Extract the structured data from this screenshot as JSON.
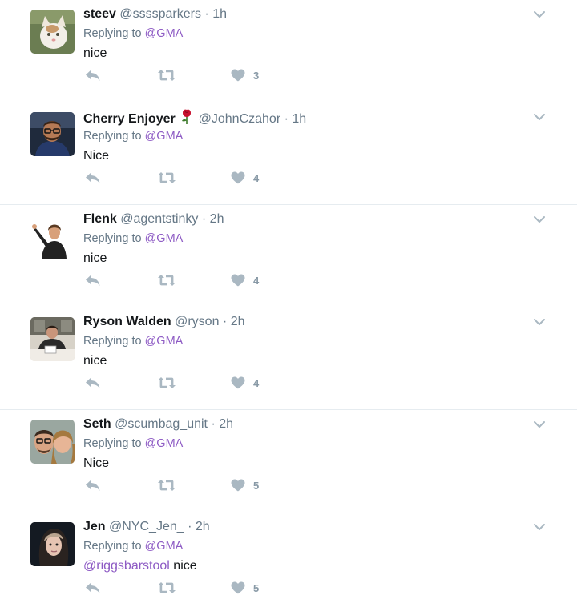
{
  "colors": {
    "accent": "#8d5ac4",
    "muted": "#657786",
    "icon": "#aab8c2",
    "text": "#14171a"
  },
  "tweets": [
    {
      "name": "steev",
      "handle": "@ssssparkers",
      "dot": "·",
      "time": "1h",
      "reply_prefix": "Replying to",
      "reply_to": "@GMA",
      "text_mention": "",
      "text": "nice",
      "likes": "3",
      "avatar_icon": "cat-avatar",
      "emoji": ""
    },
    {
      "name": "Cherry Enjoyer",
      "handle": "@JohnCzahor",
      "dot": "·",
      "time": "1h",
      "reply_prefix": "Replying to",
      "reply_to": "@GMA",
      "text_mention": "",
      "text": "Nice",
      "likes": "4",
      "avatar_icon": "man-glasses-avatar",
      "emoji": "rose-emoji"
    },
    {
      "name": "Flenk",
      "handle": "@agentstinky",
      "dot": "·",
      "time": "2h",
      "reply_prefix": "Replying to",
      "reply_to": "@GMA",
      "text_mention": "",
      "text": "nice",
      "likes": "4",
      "avatar_icon": "pointing-man-avatar",
      "emoji": ""
    },
    {
      "name": "Ryson Walden",
      "handle": "@ryson",
      "dot": "·",
      "time": "2h",
      "reply_prefix": "Replying to",
      "reply_to": "@GMA",
      "text_mention": "",
      "text": "nice",
      "likes": "4",
      "avatar_icon": "man-at-desk-avatar",
      "emoji": ""
    },
    {
      "name": "Seth",
      "handle": "@scumbag_unit",
      "dot": "·",
      "time": "2h",
      "reply_prefix": "Replying to",
      "reply_to": "@GMA",
      "text_mention": "",
      "text": "Nice",
      "likes": "5",
      "avatar_icon": "couple-selfie-avatar",
      "emoji": ""
    },
    {
      "name": "Jen",
      "handle": "@NYC_Jen_",
      "dot": "·",
      "time": "2h",
      "reply_prefix": "Replying to",
      "reply_to": "@GMA",
      "text_mention": "@riggsbarstool",
      "text": "nice",
      "likes": "5",
      "avatar_icon": "woman-selfie-avatar",
      "emoji": ""
    }
  ]
}
